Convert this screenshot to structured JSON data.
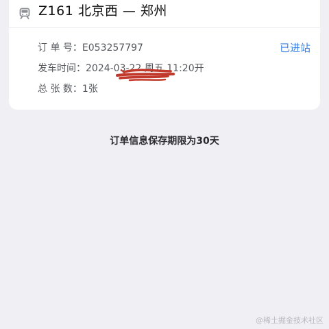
{
  "order": {
    "route_title": "Z161  北京西 — 郑州",
    "status": "已进站",
    "order_no_label": "订 单 号：",
    "order_no": "E053257797",
    "depart_label": "发车时间：",
    "depart_time": "2024-03-22  周五  11:20开",
    "count_label": "总 张 数：",
    "count": "1张"
  },
  "footer": {
    "retention_note": "订单信息保存期限为30天"
  },
  "watermark": "@稀土掘金技术社区",
  "icons": {
    "header": "train-icon"
  },
  "colors": {
    "accent": "#3b82e6",
    "background": "#efeff4",
    "card": "#ffffff",
    "redaction": "#c0392b"
  }
}
